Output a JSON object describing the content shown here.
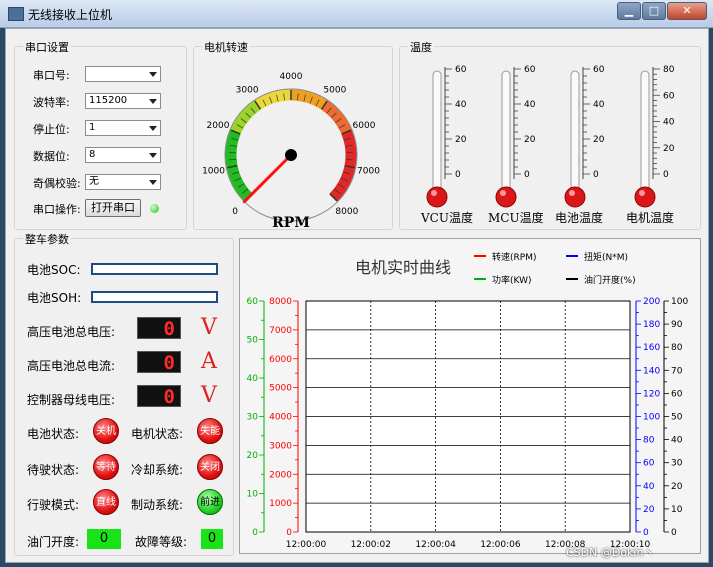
{
  "window": {
    "title": "无线接收上位机",
    "min_label": "▁",
    "max_label": "□",
    "close_label": "✕"
  },
  "serial": {
    "group_title": "串口设置",
    "port_label": "串口号:",
    "port_value": "",
    "baud_label": "波特率:",
    "baud_value": "115200",
    "stop_label": "停止位:",
    "stop_value": "1",
    "data_label": "数据位:",
    "data_value": "8",
    "parity_label": "奇偶校验:",
    "parity_value": "无",
    "op_label": "串口操作:",
    "open_button": "打开串口"
  },
  "speed": {
    "group_title": "电机转速",
    "ticks": [
      "0",
      "1000",
      "2000",
      "3000",
      "4000",
      "5000",
      "6000",
      "7000",
      "8000"
    ],
    "unit": "RPM",
    "value": 0
  },
  "temperature": {
    "group_title": "温度",
    "thermometers": [
      {
        "label": "VCU温度",
        "ticks": [
          "60",
          "40",
          "20",
          "0"
        ]
      },
      {
        "label": "MCU温度",
        "ticks": [
          "60",
          "40",
          "20",
          "0"
        ]
      },
      {
        "label": "电池温度",
        "ticks": [
          "60",
          "40",
          "20",
          "0"
        ]
      },
      {
        "label": "电机温度",
        "ticks": [
          "80",
          "60",
          "40",
          "20",
          "0"
        ]
      }
    ]
  },
  "vehicle": {
    "group_title": "整车参数",
    "soc_label": "电池SOC:",
    "soc_value": 0,
    "soh_label": "电池SOH:",
    "soh_value": 0,
    "hv_voltage_label": "高压电池总电压:",
    "hv_voltage_value": "0",
    "hv_voltage_unit": "V",
    "hv_current_label": "高压电池总电流:",
    "hv_current_value": "0",
    "hv_current_unit": "A",
    "bus_voltage_label": "控制器母线电压:",
    "bus_voltage_value": "0",
    "bus_voltage_unit": "V",
    "battery_state_label": "电池状态:",
    "battery_state_value": "关机",
    "motor_state_label": "电机状态:",
    "motor_state_value": "失能",
    "standby_label": "待驶状态:",
    "standby_value": "等待",
    "cooling_label": "冷却系统:",
    "cooling_value": "关闭",
    "drive_mode_label": "行驶模式:",
    "drive_mode_value": "直线",
    "brake_label": "制动系统:",
    "brake_value": "前进",
    "throttle_label": "油门开度:",
    "throttle_value": "0",
    "fault_label": "故障等级:",
    "fault_value": "0"
  },
  "colors": {
    "speed": "#ff0000",
    "torque": "#0000ff",
    "power": "#00b000",
    "throttle": "#000000"
  },
  "chart_data": {
    "type": "line",
    "title": "电机实时曲线",
    "x": [
      "12:00:00",
      "12:00:02",
      "12:00:04",
      "12:00:06",
      "12:00:08",
      "12:00:10"
    ],
    "grid": true,
    "legend_position": "top-right",
    "axes": [
      {
        "id": "power",
        "side": "left",
        "ylim": [
          0,
          60
        ],
        "ticks": [
          "0",
          "10",
          "20",
          "30",
          "40",
          "50",
          "60"
        ]
      },
      {
        "id": "speed",
        "side": "left",
        "ylim": [
          0,
          8000
        ],
        "ticks": [
          "0",
          "1000",
          "2000",
          "3000",
          "4000",
          "5000",
          "6000",
          "7000",
          "8000"
        ]
      },
      {
        "id": "torque",
        "side": "right",
        "ylim": [
          0,
          200
        ],
        "ticks": [
          "0",
          "20",
          "40",
          "60",
          "80",
          "100",
          "120",
          "140",
          "160",
          "180",
          "200"
        ]
      },
      {
        "id": "throttle",
        "side": "right",
        "ylim": [
          0,
          100
        ],
        "ticks": [
          "0",
          "10",
          "20",
          "30",
          "40",
          "50",
          "60",
          "70",
          "80",
          "90",
          "100"
        ]
      }
    ],
    "series": [
      {
        "name": "转速(RPM)",
        "axis": "speed",
        "values": []
      },
      {
        "name": "扭矩(N*M)",
        "axis": "torque",
        "values": []
      },
      {
        "name": "功率(KW)",
        "axis": "power",
        "values": []
      },
      {
        "name": "油门开度(%)",
        "axis": "throttle",
        "values": []
      }
    ]
  },
  "watermark": "CSDN @Dokin丶"
}
